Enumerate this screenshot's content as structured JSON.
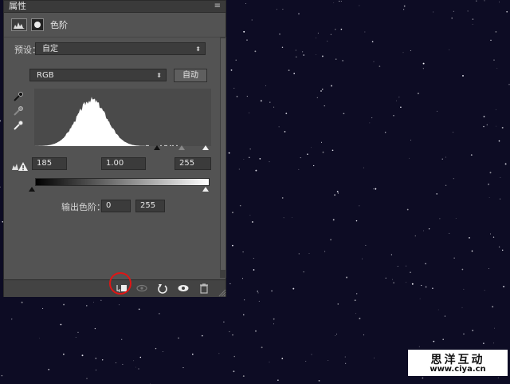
{
  "panel": {
    "title": "属性",
    "menu_glyph": "≡",
    "adjustment_label": "色阶"
  },
  "preset": {
    "label": "预设：",
    "value": "自定"
  },
  "channel": {
    "value": "RGB",
    "auto_label": "自动"
  },
  "input_levels": {
    "black": "185",
    "gamma": "1.00",
    "white": "255"
  },
  "output_levels": {
    "label": "输出色阶：",
    "black": "0",
    "white": "255"
  },
  "footer_icons": [
    "clip-to-layer-icon",
    "visibility-link-icon",
    "reset-icon",
    "eye-icon",
    "trash-icon"
  ],
  "watermark": {
    "name": "思洋互动",
    "url": "www.ciya.cn"
  },
  "colors": {
    "background": "#0d0c24",
    "panel": "#535353",
    "highlight_ring": "#e01515"
  }
}
